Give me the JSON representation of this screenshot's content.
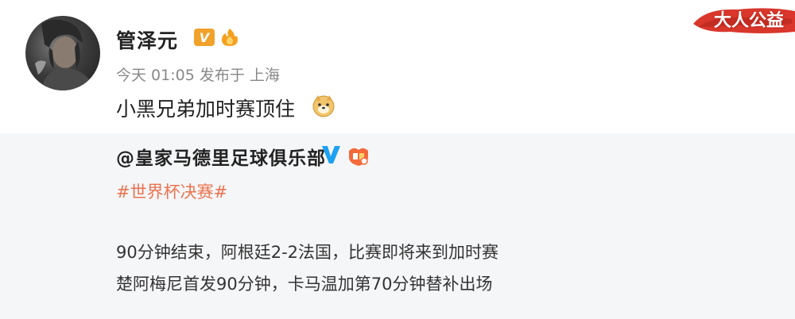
{
  "post": {
    "username": "管泽元",
    "verified_badge": "V",
    "meta": "今天 01:05 发布于 上海",
    "text": "小黑兄弟加时赛顶住",
    "emoji": "doge-icon"
  },
  "watermark": {
    "text": "大人公益"
  },
  "repost": {
    "author": "@皇家马德里足球俱乐部",
    "hashtag": "#世界杯决赛#",
    "lines": [
      "90分钟结束，阿根廷2-2法国，比赛即将来到加时赛",
      "楚阿梅尼首发90分钟，卡马温加第70分钟替补出场"
    ]
  },
  "colors": {
    "hashtag": "#eb7350",
    "verified_orange": "#f1a22b",
    "verified_blue": "#1da1f2",
    "meta_gray": "#888888",
    "repost_bg": "#f5f6f8"
  }
}
